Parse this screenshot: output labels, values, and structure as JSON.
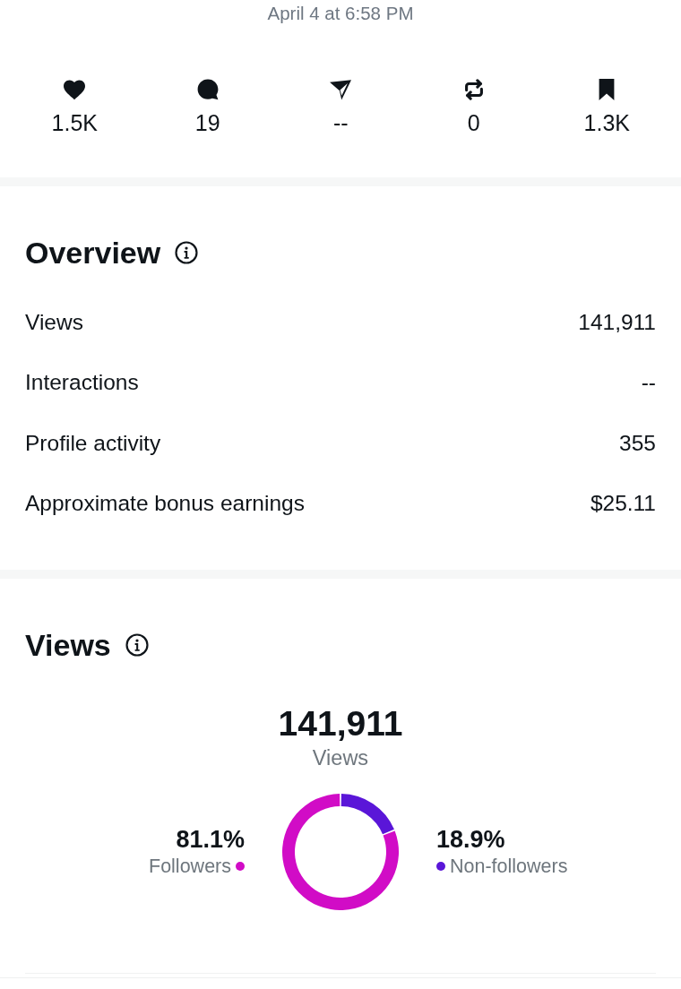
{
  "timestamp": "April 4 at 6:58 PM",
  "stats": [
    {
      "kind": "like",
      "value": "1.5K"
    },
    {
      "kind": "reply",
      "value": "19"
    },
    {
      "kind": "share",
      "value": "--"
    },
    {
      "kind": "repost",
      "value": "0"
    },
    {
      "kind": "bookmark",
      "value": "1.3K"
    }
  ],
  "overview": {
    "title": "Overview",
    "rows": [
      {
        "label": "Views",
        "value": "141,911"
      },
      {
        "label": "Interactions",
        "value": "--"
      },
      {
        "label": "Profile activity",
        "value": "355"
      },
      {
        "label": "Approximate bonus earnings",
        "value": "$25.11"
      }
    ]
  },
  "views": {
    "title": "Views",
    "total": "141,911",
    "total_label": "Views",
    "legend": [
      {
        "percent": "81.1%",
        "label": "Followers",
        "color": "#d10cc6"
      },
      {
        "percent": "18.9%",
        "label": "Non-followers",
        "color": "#5a16d8"
      }
    ],
    "chart_data": {
      "type": "donut",
      "values": [
        81.1,
        18.9
      ]
    }
  }
}
